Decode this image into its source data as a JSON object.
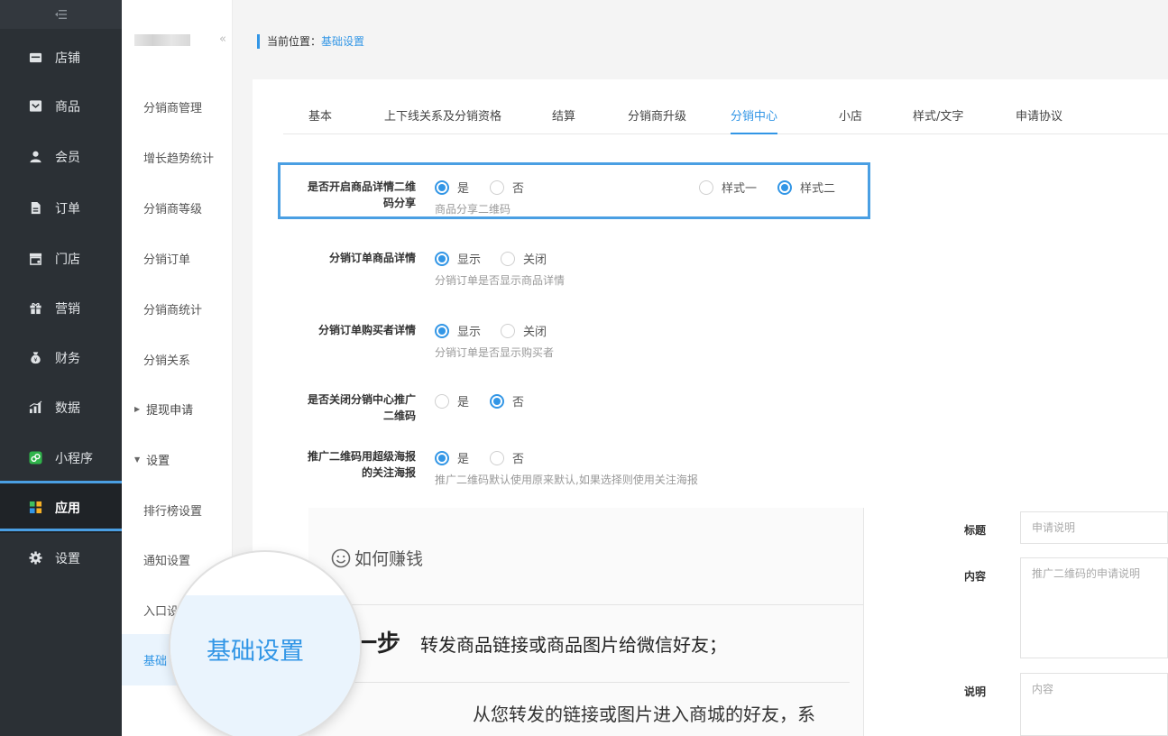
{
  "main_nav": {
    "items": [
      {
        "label": "店铺",
        "icon": "store-icon"
      },
      {
        "label": "商品",
        "icon": "goods-icon"
      },
      {
        "label": "会员",
        "icon": "member-icon"
      },
      {
        "label": "订单",
        "icon": "order-icon"
      },
      {
        "label": "门店",
        "icon": "shop-icon"
      },
      {
        "label": "营销",
        "icon": "gift-icon"
      },
      {
        "label": "财务",
        "icon": "money-bag-icon"
      },
      {
        "label": "数据",
        "icon": "bar-chart-icon"
      },
      {
        "label": "小程序",
        "icon": "mini-program-icon"
      },
      {
        "label": "应用",
        "icon": "apps-icon",
        "active": true
      },
      {
        "label": "设置",
        "icon": "gear-icon"
      }
    ]
  },
  "sub_nav": {
    "collapse_glyph": "«",
    "items": [
      {
        "label": "分销商管理"
      },
      {
        "label": "增长趋势统计"
      },
      {
        "label": "分销商等级"
      },
      {
        "label": "分销订单"
      },
      {
        "label": "分销商统计"
      },
      {
        "label": "分销关系"
      },
      {
        "label": "提现申请",
        "group": true,
        "arrow": "▶"
      },
      {
        "label": "设置",
        "group": true,
        "arrow": "▼"
      },
      {
        "label": "排行榜设置"
      },
      {
        "label": "通知设置"
      },
      {
        "label": "入口设"
      },
      {
        "label": "基础"
      }
    ]
  },
  "breadcrumb": {
    "prefix": "当前位置：",
    "current": "基础设置"
  },
  "tabs": [
    {
      "label": "基本"
    },
    {
      "label": "上下线关系及分销资格"
    },
    {
      "label": "结算"
    },
    {
      "label": "分销商升级"
    },
    {
      "label": "分销中心",
      "active": true
    },
    {
      "label": "小店"
    },
    {
      "label": "样式/文字"
    },
    {
      "label": "申请协议"
    }
  ],
  "settings": {
    "qr_share": {
      "label_line1": "是否开启商品详情二维",
      "label_line2": "码分享",
      "yes": "是",
      "no": "否",
      "value": "是",
      "hint": "商品分享二维码",
      "style_one": "样式一",
      "style_two": "样式二",
      "style_value": "样式二"
    },
    "order_goods_detail": {
      "label": "分销订单商品详情",
      "show": "显示",
      "hide": "关闭",
      "value": "显示",
      "hint": "分销订单是否显示商品详情"
    },
    "order_buyer_detail": {
      "label": "分销订单购买者详情",
      "show": "显示",
      "hide": "关闭",
      "value": "显示",
      "hint": "分销订单是否显示购买者"
    },
    "close_promo_qr": {
      "label_line1": "是否关闭分销中心推广",
      "label_line2": "二维码",
      "yes": "是",
      "no": "否",
      "value": "否"
    },
    "super_poster": {
      "label_line1": "推广二维码用超级海报",
      "label_line2": "的关注海报",
      "yes": "是",
      "no": "否",
      "value": "是",
      "hint": "推广二维码默认使用原来默认,如果选择则使用关注海报"
    }
  },
  "preview": {
    "title": "如何赚钱",
    "step_num": "一步",
    "step_text": "转发商品链接或商品图片给微信好友；",
    "desc_text": "从您转发的链接或图片进入商城的好友，系"
  },
  "form": {
    "title_label": "标题",
    "title_placeholder": "申请说明",
    "content_label": "内容",
    "content_placeholder": "推广二维码的申请说明",
    "note_label": "说明",
    "note_placeholder": "内容"
  },
  "magnifier": {
    "text": "基础设置"
  },
  "colors": {
    "accent": "#3296e6",
    "sidebar_bg": "#2b3035",
    "highlight_border": "#4a9fe3"
  }
}
